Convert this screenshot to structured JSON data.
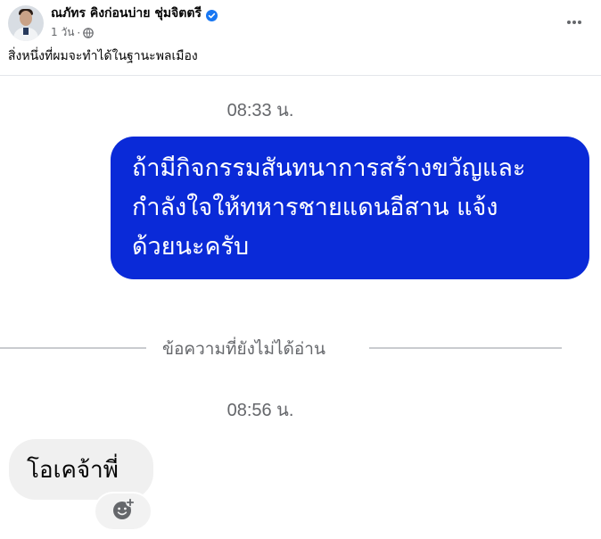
{
  "post": {
    "author": "ณภัทร คิงก่อนบ่าย ชุ่มจิตตรี",
    "timestamp": "1 วัน",
    "separator": "·",
    "caption": "สิ่งหนึ่งที่ผมจะทำได้ในฐานะพลเมือง",
    "verified_color": "#1877f2"
  },
  "chat": {
    "time_1": "08:33 น.",
    "outgoing_lines": [
      "ถ้ามีกิจกรรมสันทนาการสร้างขวัญและ",
      "กำลังใจให้ทหารชายแดนอีสาน แจ้ง",
      "ด้วยนะครับ"
    ],
    "unread_label": "ข้อความที่ยังไม่ได้อ่าน",
    "time_2": "08:56 น.",
    "incoming_text": "โอเคจ้าพี่",
    "bubble_color": "#0a2ad8"
  },
  "icons": {
    "verified": "verified-badge-icon",
    "privacy": "globe-icon",
    "more": "more-horizontal-icon",
    "react": "add-reaction-icon"
  }
}
